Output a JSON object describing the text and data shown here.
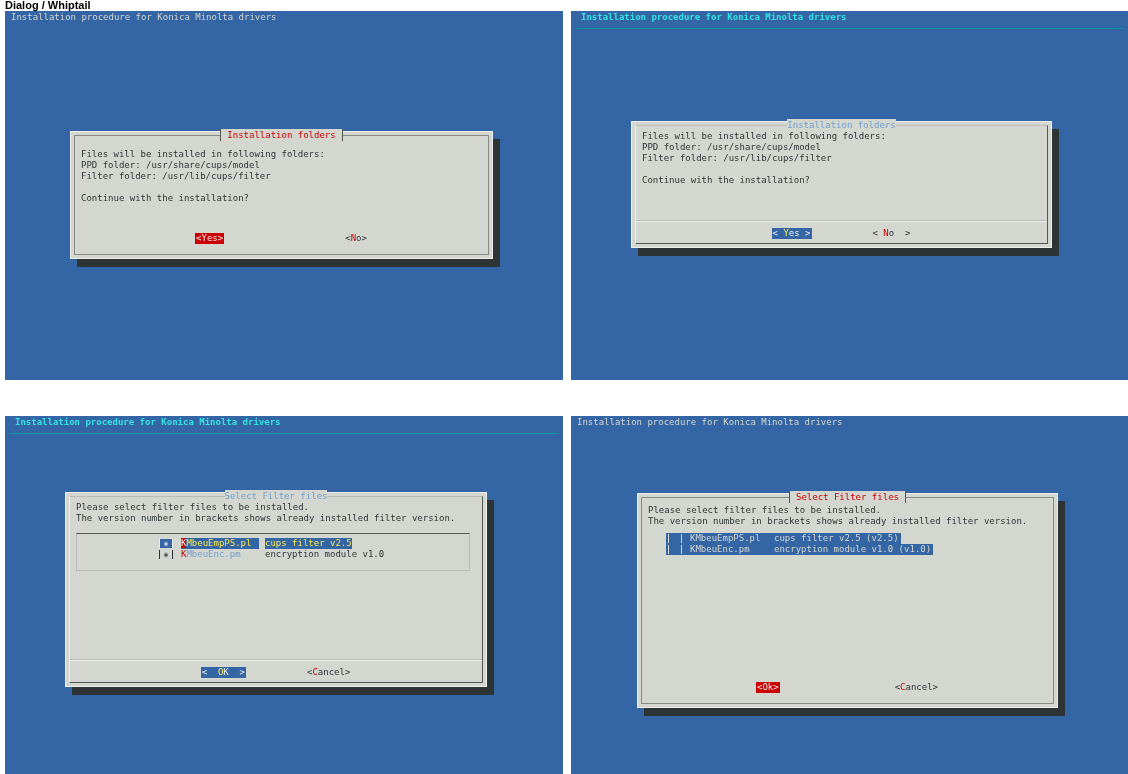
{
  "page_title": "Dialog / Whiptail",
  "screens": [
    {
      "kind": "dialog",
      "header": "Installation procedure for Konica Minolta drivers",
      "dialog": {
        "title": "Installation folders",
        "paragraphs": [
          [
            "Files will be installed in following folders:",
            "PPD folder: /usr/share/cups/model",
            "Filter folder: /usr/lib/cups/filter"
          ],
          [
            "Continue with the installation?"
          ]
        ],
        "buttons": [
          {
            "label": "<Yes>",
            "selected": true
          },
          {
            "label": "<No>",
            "selected": false
          }
        ]
      }
    },
    {
      "kind": "whiptail",
      "header": "Installation procedure for Konica Minolta drivers",
      "dialog": {
        "title": "Installation folders",
        "paragraphs": [
          [
            "Files will be installed in following folders:",
            "PPD folder: /usr/share/cups/model",
            "Filter folder: /usr/lib/cups/filter"
          ],
          [
            "Continue with the installation?"
          ]
        ],
        "buttons": [
          {
            "label": "< Yes >",
            "selected": true
          },
          {
            "label": "< No  >",
            "selected": false
          }
        ]
      }
    },
    {
      "kind": "whiptail",
      "header": "Installation procedure for Konica Minolta drivers",
      "dialog": {
        "title": "Select Filter files",
        "paragraphs": [
          [
            "Please select filter files to be installed.",
            "The version number in brackets shows already installed filter version."
          ]
        ],
        "items": [
          {
            "name": "KMbeuEmpPS.pl",
            "description": "cups filter v2.5",
            "checked": true,
            "selected": true
          },
          {
            "name": "KMbeuEnc.pm",
            "description": "encryption module v1.0",
            "checked": true,
            "selected": false
          }
        ],
        "buttons": [
          {
            "label": "<  OK  >",
            "selected": true
          },
          {
            "label": "<Cancel>",
            "selected": false
          }
        ]
      }
    },
    {
      "kind": "dialog",
      "header": "Installation procedure for Konica Minolta drivers",
      "dialog": {
        "title": "Select Filter files",
        "paragraphs": [
          [
            "Please select filter files to be installed.",
            "The version number in brackets shows already installed filter version."
          ]
        ],
        "items": [
          {
            "name": "KMbeuEmpPS.pl",
            "description": "cups filter v2.5 (v2.5)",
            "checked": false,
            "selected": true
          },
          {
            "name": "KMbeuEnc.pm",
            "description": "encryption module v1.0 (v1.0)",
            "checked": false,
            "selected": true
          }
        ],
        "buttons": [
          {
            "label": "<Ok>",
            "selected": true
          },
          {
            "label": "<Cancel>",
            "selected": false
          }
        ]
      }
    }
  ]
}
